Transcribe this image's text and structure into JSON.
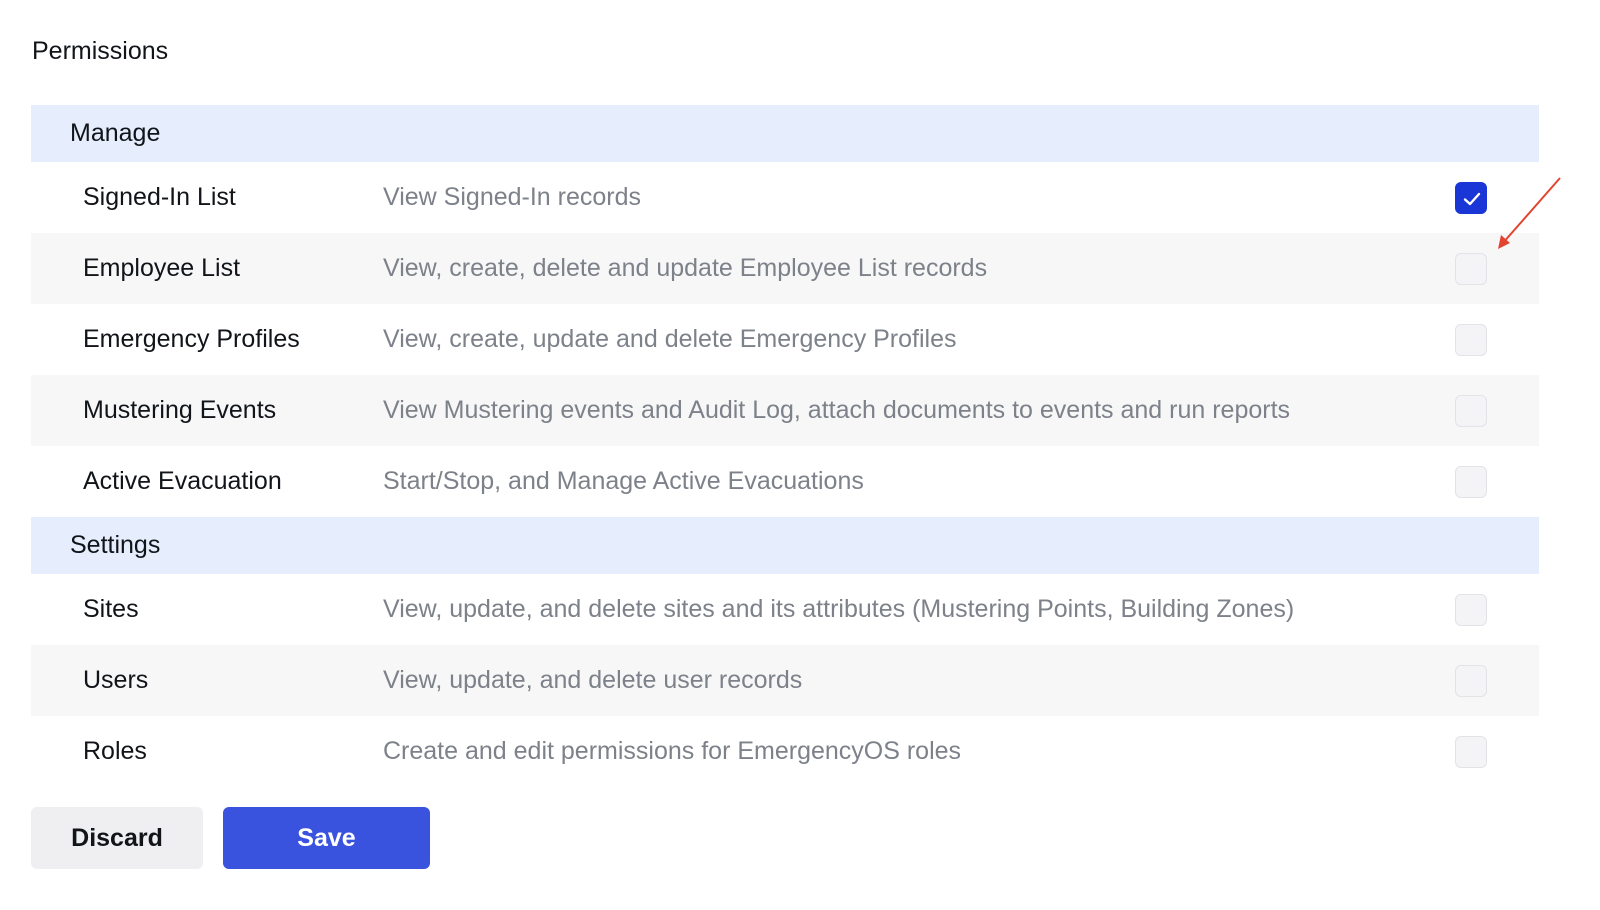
{
  "page": {
    "title": "Permissions"
  },
  "sections": [
    {
      "title": "Manage",
      "items": [
        {
          "name": "Signed-In List",
          "description": "View Signed-In records",
          "checked": true
        },
        {
          "name": "Employee List",
          "description": "View, create, delete and update Employee List records",
          "checked": false
        },
        {
          "name": "Emergency Profiles",
          "description": "View, create, update and delete Emergency Profiles",
          "checked": false
        },
        {
          "name": "Mustering Events",
          "description": "View Mustering events and Audit Log, attach documents to events and run reports",
          "checked": false
        },
        {
          "name": "Active Evacuation",
          "description": "Start/Stop, and Manage Active Evacuations",
          "checked": false
        }
      ]
    },
    {
      "title": "Settings",
      "items": [
        {
          "name": "Sites",
          "description": "View, update, and delete sites and its attributes (Mustering Points, Building Zones)",
          "checked": false
        },
        {
          "name": "Users",
          "description": "View, update, and delete user records",
          "checked": false
        },
        {
          "name": "Roles",
          "description": "Create and edit permissions for EmergencyOS roles",
          "checked": false
        }
      ]
    }
  ],
  "actions": {
    "discard_label": "Discard",
    "save_label": "Save"
  },
  "colors": {
    "section_header_bg": "#e6edfd",
    "checkbox_checked": "#1a36d6",
    "save_button": "#3a53df",
    "annotation_arrow": "#e2452f"
  },
  "icons": {
    "checkmark": "check-icon",
    "annotation": "red-arrow-annotation"
  }
}
